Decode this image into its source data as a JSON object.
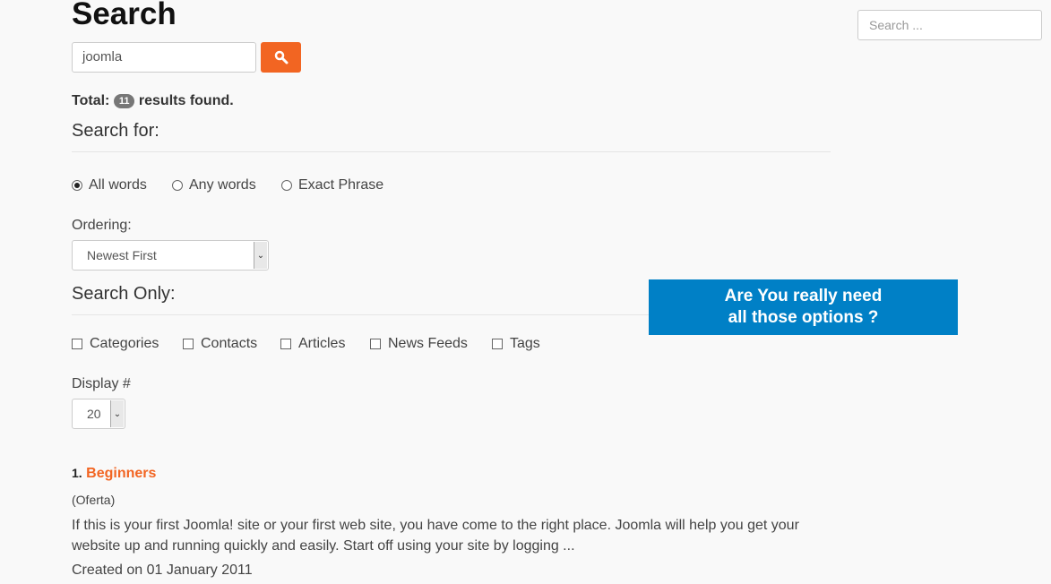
{
  "page": {
    "title": "Search"
  },
  "search": {
    "value": "joomla",
    "button_icon": "search-icon"
  },
  "total": {
    "label": "Total:",
    "count": "11",
    "suffix": "results found."
  },
  "search_for": {
    "legend": "Search for:",
    "options": [
      {
        "label": "All words",
        "checked": true
      },
      {
        "label": "Any words",
        "checked": false
      },
      {
        "label": "Exact Phrase",
        "checked": false
      }
    ]
  },
  "ordering": {
    "label": "Ordering:",
    "value": "Newest First"
  },
  "search_only": {
    "legend": "Search Only:",
    "options": [
      "Categories",
      "Contacts",
      "Articles",
      "News Feeds",
      "Tags"
    ]
  },
  "display": {
    "label": "Display #",
    "value": "20"
  },
  "callout": {
    "line1": "Are You really need",
    "line2": "all those options ?",
    "color": "#0080c6"
  },
  "sidebar": {
    "search_placeholder": "Search ..."
  },
  "results": [
    {
      "number": "1.",
      "title": "Beginners",
      "category": "(Oferta)",
      "text": "If this is your first Joomla! site or your first web site, you have come to the right place. Joomla will help you get your website up and running quickly and easily. Start off using your site by logging ...",
      "created": "Created on 01 January 2011"
    }
  ],
  "colors": {
    "accent": "#f26522"
  }
}
